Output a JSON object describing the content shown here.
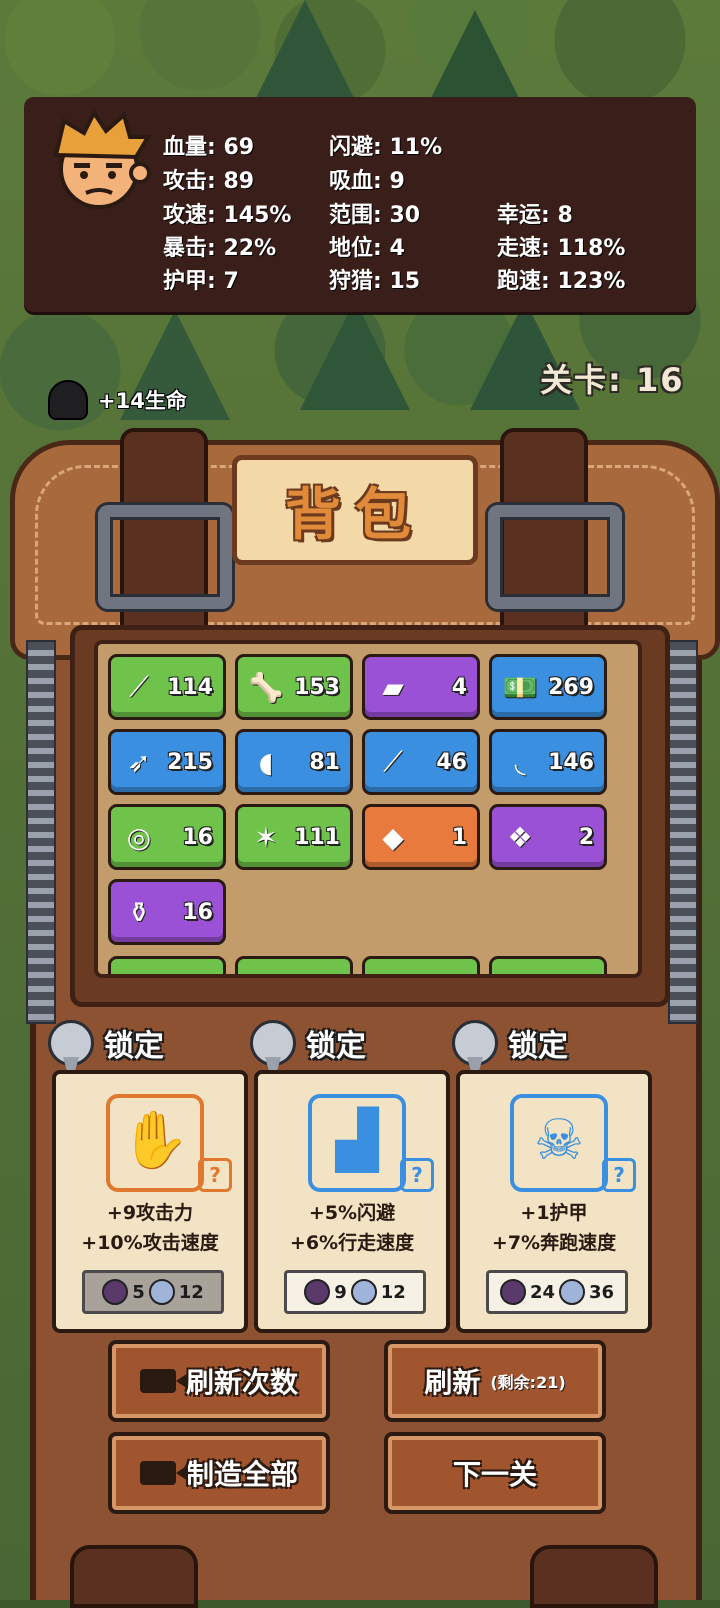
{
  "stats": {
    "hp": "血量: 69",
    "dodge": "闪避: 11%",
    "attack": "攻击: 89",
    "lifesteal": "吸血: 9",
    "attack_speed": "攻速: 145%",
    "range": "范围: 30",
    "luck": "幸运: 8",
    "crit": "暴击: 22%",
    "status": "地位: 4",
    "walk_speed": "走速: 118%",
    "armor": "护甲: 7",
    "hunting": "狩猎: 15",
    "run_speed": "跑速: 123%"
  },
  "hud": {
    "life_bonus": "+14生命",
    "level": "关卡: 16"
  },
  "backpack": {
    "title": "背包",
    "items": [
      {
        "icon": "stick-icon",
        "count": "114",
        "color": "#6fc24a"
      },
      {
        "icon": "bone-icon",
        "count": "153",
        "color": "#6fc24a"
      },
      {
        "icon": "iron-ingot-icon",
        "count": "4",
        "color": "#9b51d6"
      },
      {
        "icon": "money-icon",
        "count": "269",
        "color": "#3a8fe0"
      },
      {
        "icon": "feather-icon",
        "count": "215",
        "color": "#3a8fe0"
      },
      {
        "icon": "tooth-icon",
        "count": "81",
        "color": "#3a8fe0"
      },
      {
        "icon": "fang-icon",
        "count": "46",
        "color": "#3a8fe0"
      },
      {
        "icon": "claw-icon",
        "count": "146",
        "color": "#3a8fe0"
      },
      {
        "icon": "rope-icon",
        "count": "16",
        "color": "#6fc24a"
      },
      {
        "icon": "leather-icon",
        "count": "111",
        "color": "#6fc24a"
      },
      {
        "icon": "ruby-icon",
        "count": "1",
        "color": "#e87a3e"
      },
      {
        "icon": "crystal-icon",
        "count": "2",
        "color": "#9b51d6"
      },
      {
        "icon": "potion-icon",
        "count": "16",
        "color": "#9b51d6"
      }
    ]
  },
  "cards": [
    {
      "lock_label": "锁定",
      "icon": "gauntlet-icon",
      "color": "#e0782e",
      "line1": "+9攻击力",
      "line2": "+10%攻击速度",
      "cost": [
        {
          "icon": "potion-icon",
          "amount": "5"
        },
        {
          "icon": "iron-ingot-icon",
          "amount": "12"
        }
      ],
      "cost_bg": "#a9a29a"
    },
    {
      "lock_label": "锁定",
      "icon": "boot-icon",
      "color": "#3a8fe0",
      "line1": "+5%闪避",
      "line2": "+6%行走速度",
      "cost": [
        {
          "icon": "rope-icon",
          "amount": "9"
        },
        {
          "icon": "feather-icon",
          "amount": "12"
        }
      ],
      "cost_bg": "#f6f1e4"
    },
    {
      "lock_label": "锁定",
      "icon": "skull-ring-icon",
      "color": "#3a8fe0",
      "line1": "+1护甲",
      "line2": "+7%奔跑速度",
      "cost": [
        {
          "icon": "tooth-icon",
          "amount": "24"
        },
        {
          "icon": "leather-icon",
          "amount": "36"
        }
      ],
      "cost_bg": "#f6f1e4"
    }
  ],
  "buttons": {
    "refresh_count": "刷新次数",
    "refresh": "刷新",
    "refresh_remaining": "(剩余:21)",
    "craft_all": "制造全部",
    "next_level": "下一关"
  }
}
